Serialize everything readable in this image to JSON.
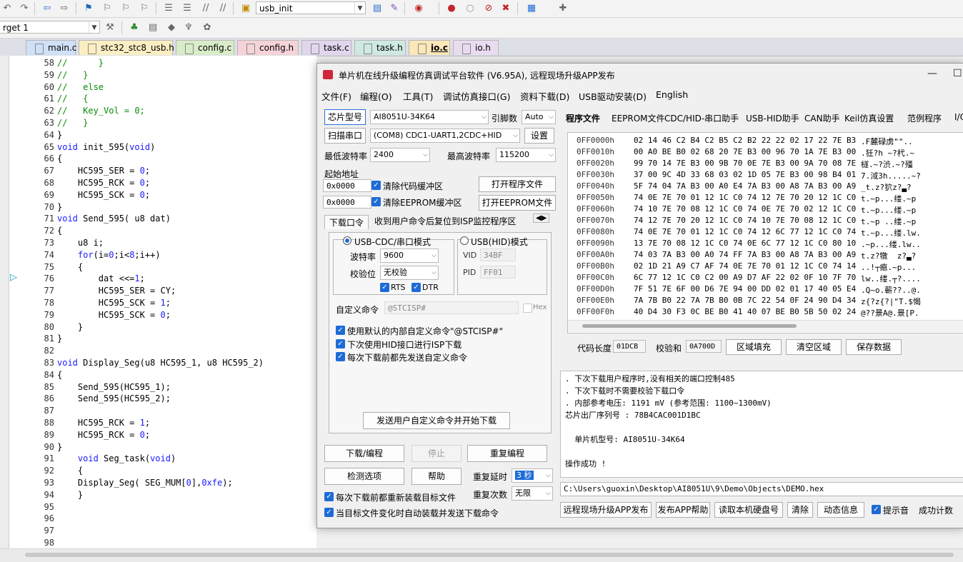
{
  "toolbar": {
    "project_combo": "usb_init",
    "target_combo": "rget 1"
  },
  "tabs": [
    {
      "label": "main.c",
      "color": "#cfe0f7"
    },
    {
      "label": "stc32_stc8_usb.h",
      "color": "#fbeec2"
    },
    {
      "label": "config.c",
      "color": "#d8ecc8"
    },
    {
      "label": "config.h",
      "color": "#f5d3d8"
    },
    {
      "label": "task.c",
      "color": "#e2d6ef"
    },
    {
      "label": "task.h",
      "color": "#cfe9e3"
    },
    {
      "label": "io.c",
      "color": "#fbe7b8"
    },
    {
      "label": "io.h",
      "color": "#e9dcf1"
    }
  ],
  "editor": {
    "line_numbers": [
      "58",
      "59",
      "60",
      "61",
      "62",
      "63",
      "64",
      "65",
      "66",
      "67",
      "68",
      "69",
      "70",
      "71",
      "72",
      "73",
      "74",
      "75",
      "76",
      "77",
      "78",
      "79",
      "80",
      "81",
      "82",
      "83",
      "84",
      "85",
      "86",
      "87",
      "88",
      "89",
      "90",
      "91",
      "92",
      "93",
      "94",
      "95",
      "96",
      "97",
      "98"
    ],
    "lines": [
      "//      }",
      "//   }",
      "//   else",
      "//   {",
      "//   Key_Vol = 0;",
      "//   }",
      "}",
      "void init_595(void)",
      "{",
      "    HC595_SER = 0;",
      "    HC595_RCK = 0;",
      "    HC595_SCK = 0;",
      "}",
      "void Send_595( u8 dat)",
      "{",
      "    u8 i;",
      "    for(i=0;i<8;i++)",
      "    {",
      "        dat <<=1;",
      "        HC595_SER = CY;",
      "        HC595_SCK = 1;",
      "        HC595_SCK = 0;",
      "    }",
      "}",
      "",
      "void Display_Seg(u8 HC595_1, u8 HC595_2)",
      "{",
      "    Send_595(HC595_1);",
      "    Send_595(HC595_2);",
      "",
      "    HC595_RCK = 1;",
      "    HC595_RCK = 0;",
      "}",
      "    void Seg_task(void)",
      "    {",
      "    Display_Seg( SEG_MUM[0],0xfe);",
      "    }",
      "",
      "",
      "",
      ""
    ]
  },
  "dialog": {
    "title": "单片机在线升级编程仿真调试平台软件 (V6.95A), 远程现场升级APP发布",
    "menu": [
      "文件(F)",
      "编程(O)",
      "工具(T)",
      "调试仿真接口(G)",
      "资料下载(D)",
      "USB驱动安装(D)",
      "English"
    ],
    "chip_label": "芯片型号",
    "chip_value": "AI8051U-34K64",
    "pins_label": "引脚数",
    "pins_value": "Auto",
    "scan_port": "扫描串口",
    "port_value": "(COM8) CDC1-UART1,2CDC+HID",
    "settings": "设置",
    "min_baud_label": "最低波特率",
    "min_baud": "2400",
    "max_baud_label": "最高波特率",
    "max_baud": "115200",
    "start_addr_label": "起始地址",
    "addr1": "0x0000",
    "addr2": "0x0000",
    "clear_code": "清除代码缓冲区",
    "clear_eeprom": "清除EEPROM缓冲区",
    "open_prog": "打开程序文件",
    "open_eeprom": "打开EEPROM文件",
    "dl_tab1": "下载口令",
    "dl_tab2": "收到用户命令后复位到ISP监控程序区",
    "usb_cdc_mode": "USB-CDC/串口模式",
    "usb_hid_mode": "USB(HID)模式",
    "baud_label": "波特率",
    "baud_value": "9600",
    "parity_label": "校验位",
    "parity_value": "无校验",
    "rts": "RTS",
    "dtr": "DTR",
    "vid_label": "VID",
    "vid_value": "34BF",
    "pid_label": "PID",
    "pid_value": "FF01",
    "custom_cmd_label": "自定义命令",
    "custom_cmd_value": "@STCISP#",
    "hex_label": "Hex",
    "opt1": "使用默认的内部自定义命令\"@STCISP#\"",
    "opt2": "下次使用HID接口进行ISP下载",
    "opt3": "每次下载前都先发送自定义命令",
    "send_cmd_btn": "发送用户自定义命令并开始下载",
    "download_btn": "下载/编程",
    "stop_btn": "停止",
    "reprogram_btn": "重复编程",
    "detect_btn": "检测选项",
    "help_btn": "帮助",
    "repeat_delay_label": "重复延时",
    "repeat_delay": "3 秒",
    "repeat_count_label": "重复次数",
    "repeat_count": "无限",
    "reload_opt": "每次下载前都重新装载目标文件",
    "auto_opt": "当目标文件变化时自动装载并发送下载命令",
    "right_tabs": [
      "程序文件",
      "EEPROM文件",
      "CDC/HID-串口助手",
      "USB-HID助手",
      "CAN助手",
      "Keil仿真设置",
      "范例程序",
      "I/O"
    ],
    "hex_rows": [
      {
        "addr": "0FF0000h",
        "bytes": "02 14 46 C2 B4 C2 B5 C2 B2 22 22 02 17 22 7E B3",
        "ascii": ".F麓碌虏\"\".."
      },
      {
        "addr": "0FF0010h",
        "bytes": "00 A0 BE B0 02 68 20 7E B3 00 96 70 1A 7E B3 00",
        "ascii": ".狅?h ~?杙.~"
      },
      {
        "addr": "0FF0020h",
        "bytes": "99 70 14 7E B3 00 9B 70 0E 7E B3 00 9A 70 08 7E",
        "ascii": "檖.~?渋.~?殭"
      },
      {
        "addr": "0FF0030h",
        "bytes": "37 00 9C 4D 33 68 03 02 1D 05 7E B3 00 98 B4 01",
        "ascii": "7.淢3h.....~?"
      },
      {
        "addr": "0FF0040h",
        "bytes": "5F 74 04 7A B3 00 A0 E4 7A B3 00 A8 7A B3 00 A9",
        "ascii": "_t.z?狖z?▃?"
      },
      {
        "addr": "0FF0050h",
        "bytes": "74 0E 7E 70 01 12 1C C0 74 12 7E 70 20 12 1C C0",
        "ascii": "t.~p...缕.~p"
      },
      {
        "addr": "0FF0060h",
        "bytes": "74 10 7E 70 08 12 1C C0 74 0E 7E 70 02 12 1C C0",
        "ascii": "t.~p...缕.~p"
      },
      {
        "addr": "0FF0070h",
        "bytes": "74 12 7E 70 20 12 1C C0 74 10 7E 70 08 12 1C C0",
        "ascii": "t.~p ..缕.~p"
      },
      {
        "addr": "0FF0080h",
        "bytes": "74 0E 7E 70 01 12 1C C0 74 12 6C 77 12 1C C0 74",
        "ascii": "t.~p...缕.lw."
      },
      {
        "addr": "0FF0090h",
        "bytes": "13 7E 70 08 12 1C C0 74 0E 6C 77 12 1C C0 80 10",
        "ascii": ".~p...缕.lw.."
      },
      {
        "addr": "0FF00A0h",
        "bytes": "74 03 7A B3 00 A0 74 FF 7A B3 00 A8 7A B3 00 A9",
        "ascii": "t.z?犜  z?▃?"
      },
      {
        "addr": "0FF00B0h",
        "bytes": "02 1D 21 A9 C7 AF 74 0E 7E 70 01 12 1C C0 74 14",
        "ascii": "..!┬瘜.~p..."
      },
      {
        "addr": "0FF00C0h",
        "bytes": "6C 77 12 1C C0 C2 00 A9 D7 AF 22 02 0F 10 7F 70",
        "ascii": "lw..缕.┬?...."
      },
      {
        "addr": "0FF00D0h",
        "bytes": "7F 51 7E 6F 00 D6 7E 94 00 DD 02 01 17 40 05 E4",
        "ascii": ".Q~o.蕲??..@."
      },
      {
        "addr": "0FF00E0h",
        "bytes": "7A 7B B0 22 7A 7B B0 0B 7C 22 54 0F 24 90 D4 34",
        "ascii": "z{?z{?|\"T.$愒"
      },
      {
        "addr": "0FF00F0h",
        "bytes": "40 D4 30 F3 0C BE B0 41 40 07 BE B0 5B 50 02 24",
        "ascii": "@??景A@.景[P."
      }
    ],
    "code_len_label": "代码长度",
    "code_len": "01DCB",
    "checksum_label": "校验和",
    "checksum": "0A700D",
    "fill_btn": "区域填充",
    "clear_btn": "清空区域",
    "save_btn": "保存数据",
    "log": [
      ". 下次下载用户程序时,没有相关的端口控制485",
      ". 下次下载时不需要校验下载口令",
      ". 内部参考电压: 1191 mV (参考范围: 1100~1300mV)",
      "芯片出厂序列号 : 78B4CAC001D1BC",
      "",
      "  单片机型号: AI8051U-34K64",
      "",
      "操作成功 !"
    ],
    "path": "C:\\Users\\guoxin\\Desktop\\AI8051U\\9\\Demo\\Objects\\DEMO.hex",
    "bottom_btns": [
      "远程现场升级APP发布",
      "发布APP帮助",
      "读取本机硬盘号",
      "清除",
      "动态信息"
    ],
    "sound_label": "提示音",
    "success_count_label": "成功计数"
  }
}
